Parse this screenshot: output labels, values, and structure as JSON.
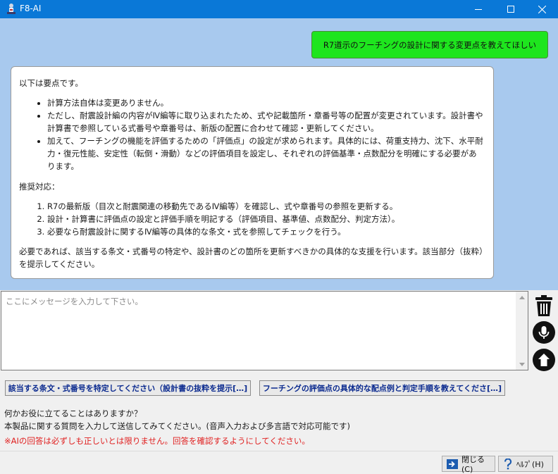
{
  "window": {
    "title": "F8-AI"
  },
  "chat": {
    "user_message": "R7道示のフーチングの設計に関する変更点を教えてほしい",
    "ai": {
      "intro": "以下は要点です。",
      "bullets": [
        "計算方法自体は変更ありません。",
        "ただし、耐震設計編の内容がⅣ編等に取り込まれたため、式や記載箇所・章番号等の配置が変更されています。設計書や計算書で参照している式番号や章番号は、新版の配置に合わせて確認・更新してください。",
        "加えて、フーチングの機能を評価するための「評価点」の設定が求められます。具体的には、荷重支持力、沈下、水平耐力・復元性能、安定性（転倒・滑動）などの評価項目を設定し、それぞれの評価基準・点数配分を明確にする必要があります。"
      ],
      "recommend_heading": "推奨対応：",
      "steps": [
        "R7の最新版（目次と耐震関連の移動先であるⅣ編等）を確認し、式や章番号の参照を更新する。",
        "設計・計算書に評価点の設定と評価手順を明記する（評価項目、基準値、点数配分、判定方法）。",
        "必要なら耐震設計に関するⅣ編等の具体的な条文・式を参照してチェックを行う。"
      ],
      "closing": "必要であれば、該当する条文・式番号の特定や、設計書のどの箇所を更新すべきかの具体的な支援を行います。該当部分（抜粋）を提示してください。"
    }
  },
  "input": {
    "placeholder": "ここにメッセージを入力して下さい。",
    "value": ""
  },
  "side_buttons": {
    "trash": "trash-icon",
    "mic": "microphone-icon",
    "send": "send-arrow-icon"
  },
  "suggestions": [
    "該当する条文・式番号を特定してください（設計書の抜粋を提示[…]",
    "フーチングの評価点の具体的な配点例と判定手順を教えてくださ[…]"
  ],
  "info": {
    "line1": "何かお役に立てることはありますか？",
    "line2": "本製品に関する質問を入力して送信してみてください。(音声入力および多言語で対応可能です)",
    "warning": "※AIの回答は必ずしも正しいとは限りません。回答を確認するようにしてください。"
  },
  "footer": {
    "close_label": "閉じる(C)",
    "help_label": "ﾍﾙﾌﾟ(H)"
  },
  "colors": {
    "titlebar": "#0a78d7",
    "chat_background": "#a8c9ee",
    "user_bubble": "#1ee51e",
    "suggestion_text": "#0b2a8f",
    "warning_text": "#e02020"
  }
}
